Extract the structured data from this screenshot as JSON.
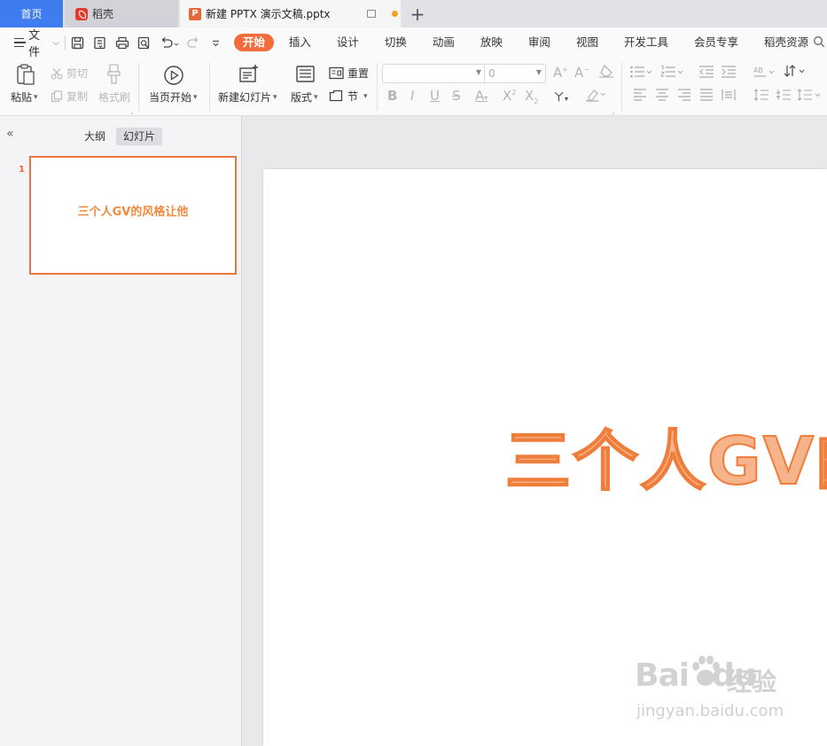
{
  "tabs": {
    "home": "首页",
    "daoke": "稻壳",
    "document": "新建 PPTX 演示文稿.pptx",
    "add": "+"
  },
  "menu": {
    "file": "文件",
    "items": [
      "开始",
      "插入",
      "设计",
      "切换",
      "动画",
      "放映",
      "审阅",
      "视图",
      "开发工具",
      "会员专享",
      "稻壳资源"
    ],
    "active": "开始"
  },
  "ribbon": {
    "paste": "粘贴",
    "cut": "剪切",
    "copy": "复制",
    "format_painter": "格式刷",
    "start_from_current": "当页开始",
    "new_slide": "新建幻灯片",
    "layout": "版式",
    "reset": "重置",
    "section": "节",
    "font_name": "",
    "font_size": "0"
  },
  "left_panel": {
    "tab_outline": "大纲",
    "tab_slides": "幻灯片",
    "active_tab": "幻灯片",
    "slides": [
      {
        "number": "1",
        "title": "三个人GV的风格让他"
      }
    ]
  },
  "slide": {
    "title": "三个人GV的风格让他"
  },
  "watermark": {
    "brand": "Bai",
    "brand2": "du",
    "cn": "经验",
    "url": "jingyan.baidu.com"
  },
  "colors": {
    "accent": "#f26d3d",
    "home_tab": "#3f7cf0",
    "title_fill": "#f7b389",
    "title_stroke": "#ef7e3c"
  }
}
